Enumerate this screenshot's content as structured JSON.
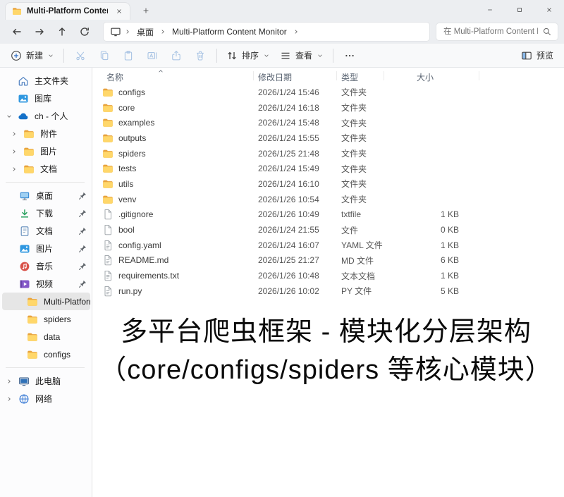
{
  "tab": {
    "title": "Multi-Platform Content Monit"
  },
  "breadcrumb": {
    "items": [
      "桌面",
      "Multi-Platform Content Monitor"
    ]
  },
  "search": {
    "placeholder": "在 Multi-Platform Content Mc"
  },
  "toolbar": {
    "new": "新建",
    "sort": "排序",
    "view": "查看",
    "preview": "预览"
  },
  "sidebar": {
    "items": [
      {
        "label": "主文件夹",
        "icon": "home-icon"
      },
      {
        "label": "图库",
        "icon": "gallery-icon"
      },
      {
        "label": "ch - 个人",
        "icon": "onedrive-icon"
      },
      {
        "label": "附件",
        "icon": "folder-icon"
      },
      {
        "label": "图片",
        "icon": "folder-icon"
      },
      {
        "label": "文档",
        "icon": "folder-icon"
      },
      {
        "label": "桌面",
        "icon": "desktop-icon",
        "pinned": true
      },
      {
        "label": "下载",
        "icon": "download-icon",
        "pinned": true
      },
      {
        "label": "文档",
        "icon": "documents-icon",
        "pinned": true
      },
      {
        "label": "图片",
        "icon": "pictures-icon",
        "pinned": true
      },
      {
        "label": "音乐",
        "icon": "music-icon",
        "pinned": true
      },
      {
        "label": "视频",
        "icon": "videos-icon",
        "pinned": true
      },
      {
        "label": "Multi-Platform Conte",
        "icon": "folder-icon",
        "selected": true
      },
      {
        "label": "spiders",
        "icon": "folder-icon"
      },
      {
        "label": "data",
        "icon": "folder-icon"
      },
      {
        "label": "configs",
        "icon": "folder-icon"
      },
      {
        "label": "此电脑",
        "icon": "thispc-icon"
      },
      {
        "label": "网络",
        "icon": "network-icon"
      }
    ]
  },
  "files": {
    "headers": {
      "name": "名称",
      "date": "修改日期",
      "type": "类型",
      "size": "大小"
    },
    "rows": [
      {
        "name": "configs",
        "date": "2026/1/24 15:46",
        "type": "文件夹",
        "size": "",
        "icon": "folder-icon"
      },
      {
        "name": "core",
        "date": "2026/1/24 16:18",
        "type": "文件夹",
        "size": "",
        "icon": "folder-icon"
      },
      {
        "name": "examples",
        "date": "2026/1/24 15:48",
        "type": "文件夹",
        "size": "",
        "icon": "folder-icon"
      },
      {
        "name": "outputs",
        "date": "2026/1/24 15:55",
        "type": "文件夹",
        "size": "",
        "icon": "folder-icon"
      },
      {
        "name": "spiders",
        "date": "2026/1/25 21:48",
        "type": "文件夹",
        "size": "",
        "icon": "folder-icon"
      },
      {
        "name": "tests",
        "date": "2026/1/24 15:49",
        "type": "文件夹",
        "size": "",
        "icon": "folder-icon"
      },
      {
        "name": "utils",
        "date": "2026/1/24 16:10",
        "type": "文件夹",
        "size": "",
        "icon": "folder-icon"
      },
      {
        "name": "venv",
        "date": "2026/1/26 10:54",
        "type": "文件夹",
        "size": "",
        "icon": "folder-icon"
      },
      {
        "name": ".gitignore",
        "date": "2026/1/26 10:49",
        "type": "txtfile",
        "size": "1 KB",
        "icon": "file-icon"
      },
      {
        "name": "bool",
        "date": "2026/1/24 21:55",
        "type": "文件",
        "size": "0 KB",
        "icon": "file-icon"
      },
      {
        "name": "config.yaml",
        "date": "2026/1/24 16:07",
        "type": "YAML 文件",
        "size": "1 KB",
        "icon": "file-lines-icon"
      },
      {
        "name": "README.md",
        "date": "2026/1/25 21:27",
        "type": "MD 文件",
        "size": "6 KB",
        "icon": "file-lines-icon"
      },
      {
        "name": "requirements.txt",
        "date": "2026/1/26 10:48",
        "type": "文本文档",
        "size": "1 KB",
        "icon": "file-lines-icon"
      },
      {
        "name": "run.py",
        "date": "2026/1/26 10:02",
        "type": "PY 文件",
        "size": "5 KB",
        "icon": "file-lines-icon"
      }
    ]
  },
  "overlay": {
    "line1": "多平台爬虫框架 - 模块化分层架构",
    "line2": "（core/configs/spiders 等核心模块）"
  },
  "colors": {
    "accent": "#2b6cc4",
    "folder_front": "#ffd76a",
    "folder_back": "#e8a33d",
    "selection": "#e6e6e6"
  }
}
